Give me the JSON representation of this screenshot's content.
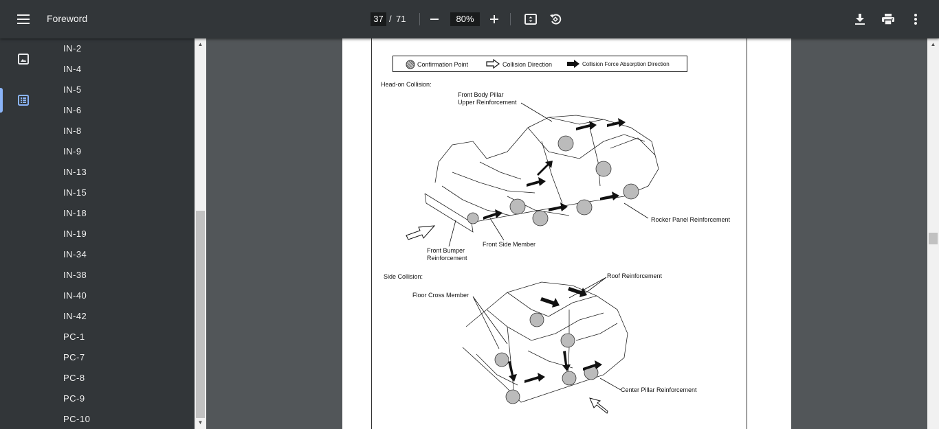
{
  "toolbar": {
    "title": "Foreword",
    "current_page": "37",
    "page_separator": "/",
    "total_pages": "71",
    "zoom": "80%",
    "icons": [
      "menu-icon",
      "zoom-out-icon",
      "zoom-in-icon",
      "fit-page-icon",
      "rotate-icon",
      "download-icon",
      "print-icon",
      "more-vert-icon"
    ]
  },
  "sidebar": {
    "icons": [
      "thumbnail-icon",
      "outline-icon"
    ],
    "outline": [
      "IN-2",
      "IN-4",
      "IN-5",
      "IN-6",
      "IN-8",
      "IN-9",
      "IN-13",
      "IN-15",
      "IN-18",
      "IN-19",
      "IN-34",
      "IN-38",
      "IN-40",
      "IN-42",
      "PC-1",
      "PC-7",
      "PC-8",
      "PC-9",
      "PC-10"
    ]
  },
  "document": {
    "legend": {
      "confirmation_point": "Confirmation Point",
      "collision_direction": "Collision Direction",
      "absorption_direction": "Collision Force Absorption Direction"
    },
    "head_on": {
      "heading": "Head-on Collision:",
      "labels": {
        "front_body_pillar_1": "Front Body Pillar",
        "front_body_pillar_2": "Upper Reinforcement",
        "rocker_panel": "Rocker Panel Reinforcement",
        "front_side_member": "Front Side Member",
        "front_bumper_1": "Front Bumper",
        "front_bumper_2": "Reinforcement"
      }
    },
    "side": {
      "heading": "Side Collision:",
      "labels": {
        "roof": "Roof Reinforcement",
        "floor_cross": "Floor Cross Member",
        "center_pillar": "Center Pillar Reinforcement"
      }
    }
  }
}
